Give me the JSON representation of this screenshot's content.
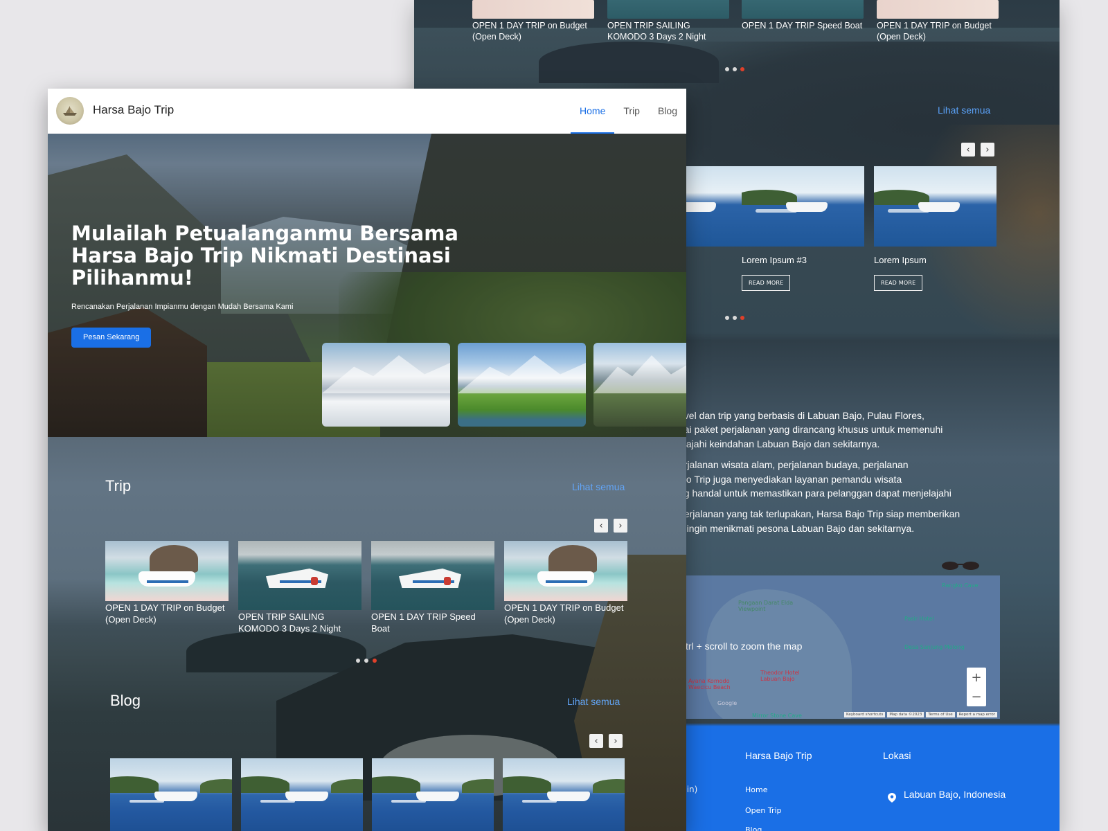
{
  "back": {
    "trips": [
      "OPEN 1 DAY TRIP on Budget (Open Deck)",
      "OPEN TRIP SAILING KOMODO 3 Days 2 Night",
      "OPEN 1 DAY TRIP Speed Boat",
      "OPEN 1 DAY TRIP on Budget (Open Deck)"
    ],
    "lihat_semua": "Lihat semua",
    "blog_cards": [
      {
        "title": "Lorem Ipsum #3",
        "button": "READ MORE"
      },
      {
        "title": "Lorem Ipsum",
        "button": "READ MORE"
      }
    ],
    "about_lines": [
      "avel dan trip yang berbasis di Labuan Bajo, Pulau Flores,",
      "gai paket perjalanan yang dirancang khusus untuk memenuhi",
      "elajahi keindahan Labuan Bajo dan sekitarnya.",
      "erjalanan wisata alam, perjalanan budaya, perjalanan",
      "ajo Trip juga menyediakan layanan pemandu wisata",
      "ng handal untuk memastikan para pelanggan dapat menjelajahi",
      "perjalanan yang tak terlupakan, Harsa Bajo Trip siap memberikan",
      "g ingin menikmati pesona Labuan Bajo dan sekitarnya."
    ],
    "map": {
      "hint": "trl + scroll to zoom the map",
      "zoom_in": "+",
      "zoom_out": "−",
      "labels": [
        "Pangaan Darat Elda Viewpoint",
        "Rangko Cave",
        "Pasir Hotel",
        "Desa Sanjung Molong",
        "Ayana Komodo Waecicu Beach",
        "Theodor Hotel Labuan Bajo",
        "Mirror Stone Cave",
        "Google"
      ],
      "attribution": [
        "Keyboard shortcuts",
        "Map data ©2023",
        "Terms of Use",
        "Report a map error"
      ]
    },
    "footer": {
      "title1": "Harsa Bajo Trip",
      "title2": "Lokasi",
      "links": [
        "Home",
        "Open Trip",
        "Blog"
      ],
      "location": "Labuan Bajo, Indonesia",
      "partial_left": "min)"
    }
  },
  "nav": {
    "brand": "Harsa Bajo Trip",
    "items": [
      {
        "label": "Home",
        "active": true
      },
      {
        "label": "Trip",
        "active": false
      },
      {
        "label": "Blog",
        "active": false
      }
    ]
  },
  "hero": {
    "title": "Mulailah Petualanganmu Bersama Harsa Bajo Trip Nikmati Destinasi Pilihanmu!",
    "subtitle": "Rencanakan Perjalanan Impianmu dengan Mudah Bersama Kami",
    "cta": "Pesan Sekarang"
  },
  "trip": {
    "title": "Trip",
    "lihat_semua": "Lihat semua",
    "prev_icon": "‹",
    "next_icon": "›",
    "cards": [
      "OPEN 1 DAY TRIP on Budget (Open Deck)",
      "OPEN TRIP SAILING KOMODO 3 Days 2 Night",
      "OPEN 1 DAY TRIP Speed Boat",
      "OPEN 1 DAY TRIP on Budget (Open Deck)"
    ]
  },
  "blog": {
    "title": "Blog",
    "lihat_semua": "Lihat semua"
  },
  "colors": {
    "primary": "#1a6fe6",
    "link": "#62a5f7",
    "dot_active": "#e0402a"
  }
}
